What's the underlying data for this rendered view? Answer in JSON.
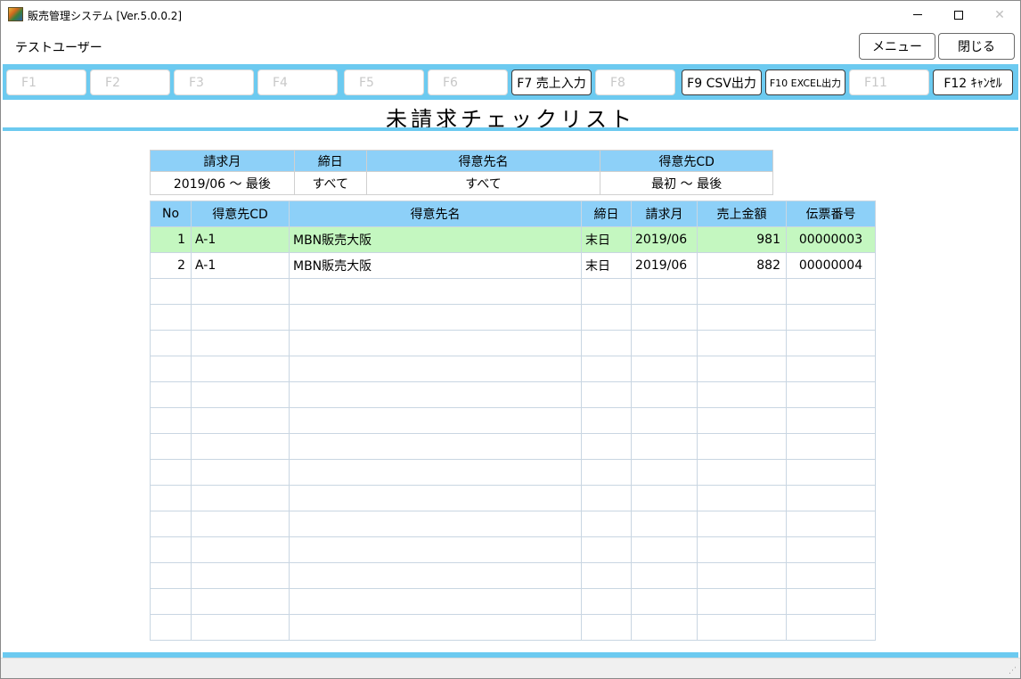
{
  "window": {
    "title": "販売管理システム [Ver.5.0.0.2]",
    "icon": "app-logo-icon"
  },
  "user": {
    "name": "テストユーザー"
  },
  "top_buttons": {
    "menu": "メニュー",
    "close": "閉じる"
  },
  "fkeys": [
    {
      "label": "F1",
      "enabled": false
    },
    {
      "label": "F2",
      "enabled": false
    },
    {
      "label": "F3",
      "enabled": false
    },
    {
      "label": "F4",
      "enabled": false
    },
    {
      "label": "F5",
      "enabled": false
    },
    {
      "label": "F6",
      "enabled": false
    },
    {
      "label": "F7 売上入力",
      "enabled": true
    },
    {
      "label": "F8",
      "enabled": false
    },
    {
      "label": "F9 CSV出力",
      "enabled": true
    },
    {
      "label": "F10 EXCEL出力",
      "enabled": true
    },
    {
      "label": "F11",
      "enabled": false
    },
    {
      "label": "F12 ｷｬﾝｾﾙ",
      "enabled": true
    }
  ],
  "page_title": "未請求チェックリスト",
  "filter": {
    "headers": [
      "請求月",
      "締日",
      "得意先名",
      "得意先CD"
    ],
    "values": [
      "2019/06 ～ 最後",
      "すべて",
      "すべて",
      "最初 ～ 最後"
    ]
  },
  "grid": {
    "headers": [
      "No",
      "得意先CD",
      "得意先名",
      "締日",
      "請求月",
      "売上金額",
      "伝票番号"
    ],
    "rows": [
      [
        "1",
        "A-1",
        "MBN販売大阪",
        "末日",
        "2019/06",
        "981",
        "00000003"
      ],
      [
        "2",
        "A-1",
        "MBN販売大阪",
        "末日",
        "2019/06",
        "882",
        "00000004"
      ]
    ],
    "selected_row": 0,
    "empty_rows": 14
  },
  "colors": {
    "accent": "#6ccaf0",
    "header_bg": "#8dd0f8",
    "selected_row": "#c4f7c0"
  }
}
